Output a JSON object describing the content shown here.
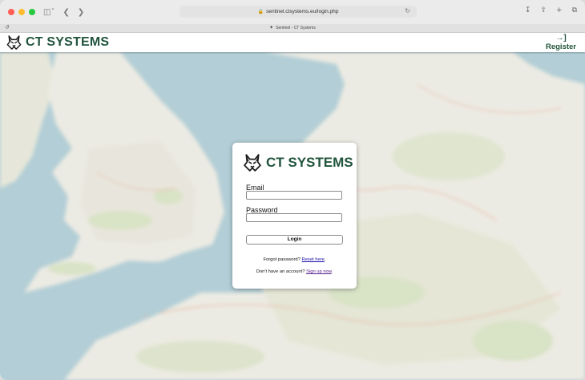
{
  "browser": {
    "url": "sentinel.ctsystems.eu/login.php",
    "tab_title": "Sentinel - CT Systems",
    "history_glyph": "↺",
    "icons": [
      "sidebar-icon",
      "back-icon",
      "forward-icon",
      "lock-icon",
      "reload-icon",
      "download-icon",
      "share-icon",
      "new-tab-icon",
      "tab-overview-icon"
    ]
  },
  "header": {
    "brand_title": "CT SYSTEMS",
    "register_label": "Register",
    "logo_icon": "fox-head-logo",
    "register_icon": "sign-in-icon"
  },
  "login": {
    "brand_title": "CT SYSTEMS",
    "email_label": "Email",
    "email_value": "",
    "password_label": "Password",
    "password_value": "",
    "login_button": "Login",
    "forgot_text": "Forgot password?",
    "reset_link": "Reset here",
    "forgot_suffix": ".",
    "signup_text": "Don't have an account?",
    "signup_link": "Sign up now",
    "signup_suffix": "."
  },
  "colors": {
    "brand": "#22543d",
    "sea": "#b3ced6",
    "land": "#ecebe3",
    "land_green": "#d9e3c6",
    "link": "#1a0dab",
    "link_visited": "#551a8b"
  }
}
